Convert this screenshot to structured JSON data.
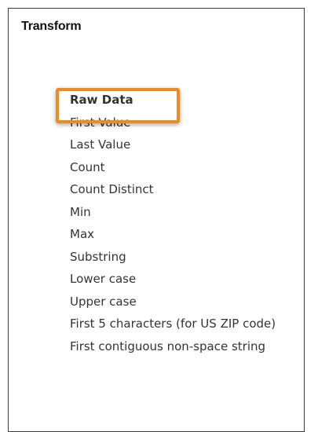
{
  "panel": {
    "title": "Transform",
    "options": [
      {
        "label": "Raw Data",
        "selected": true
      },
      {
        "label": "First Value"
      },
      {
        "label": "Last Value"
      },
      {
        "label": "Count"
      },
      {
        "label": "Count Distinct"
      },
      {
        "label": "Min"
      },
      {
        "label": "Max"
      },
      {
        "label": "Substring"
      },
      {
        "label": "Lower case"
      },
      {
        "label": "Upper case"
      },
      {
        "label": "First 5 characters (for US ZIP code)"
      },
      {
        "label": "First contiguous non-space string"
      }
    ]
  },
  "colors": {
    "highlight": "#f08a1c",
    "border": "#3a3a3a",
    "text": "#333333"
  }
}
